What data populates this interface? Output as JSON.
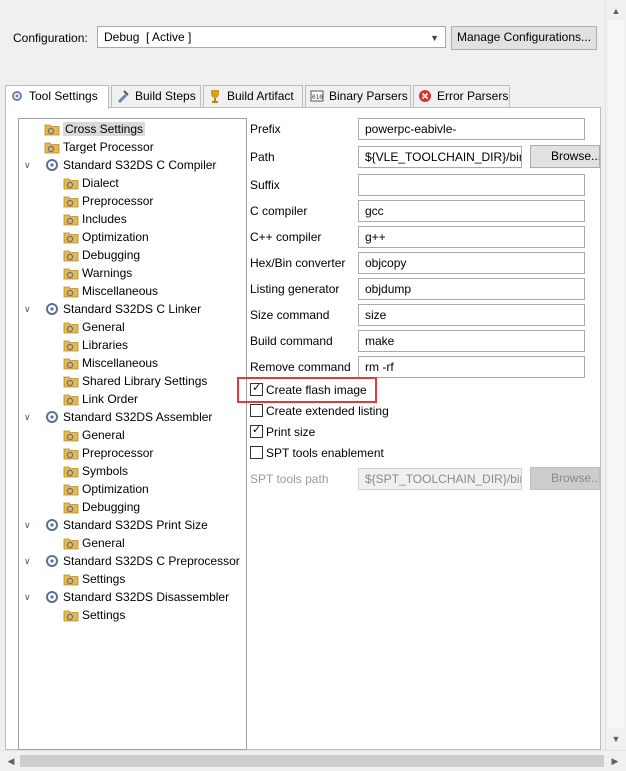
{
  "config": {
    "label": "Configuration:",
    "selected": "Debug  [ Active ]",
    "manage_button": "Manage Configurations..."
  },
  "tabs": [
    {
      "label": "Tool Settings",
      "icon": "tool-settings-icon",
      "active": true
    },
    {
      "label": "Build Steps",
      "icon": "build-steps-icon"
    },
    {
      "label": "Build Artifact",
      "icon": "build-artifact-icon"
    },
    {
      "label": "Binary Parsers",
      "icon": "binary-parsers-icon"
    },
    {
      "label": "Error Parsers",
      "icon": "error-parsers-icon"
    }
  ],
  "tree": [
    "Cross Settings",
    "Target Processor",
    "Standard S32DS C Compiler",
    "Dialect",
    "Preprocessor",
    "Includes",
    "Optimization",
    "Debugging",
    "Warnings",
    "Miscellaneous",
    "Standard S32DS C Linker",
    "General",
    "Libraries",
    "Miscellaneous",
    "Shared Library Settings",
    "Link Order",
    "Standard S32DS Assembler",
    "General",
    "Preprocessor",
    "Symbols",
    "Optimization",
    "Debugging",
    "Standard S32DS Print Size",
    "General",
    "Standard S32DS C Preprocessor",
    "Settings",
    "Standard S32DS Disassembler",
    "Settings"
  ],
  "form": {
    "prefix_label": "Prefix",
    "prefix_value": "powerpc-eabivle-",
    "path_label": "Path",
    "path_value": "${VLE_TOOLCHAIN_DIR}/bin",
    "browse_label": "Browse...",
    "suffix_label": "Suffix",
    "suffix_value": "",
    "c_compiler_label": "C compiler",
    "c_compiler_value": "gcc",
    "cpp_compiler_label": "C++ compiler",
    "cpp_compiler_value": "g++",
    "hexbin_label": "Hex/Bin converter",
    "hexbin_value": "objcopy",
    "listing_label": "Listing generator",
    "listing_value": "objdump",
    "size_label": "Size command",
    "size_value": "size",
    "build_label": "Build command",
    "build_value": "make",
    "remove_label": "Remove command",
    "remove_value": "rm -rf",
    "create_flash": "Create flash image",
    "create_listing": "Create extended listing",
    "print_size": "Print size",
    "spt_enable": "SPT tools enablement",
    "spt_path_label": "SPT tools path",
    "spt_path_value": "${SPT_TOOLCHAIN_DIR}/bin",
    "spt_browse_label": "Browse..."
  },
  "colors": {
    "highlight": "#e03a3a",
    "folder": "#e8b84a"
  }
}
